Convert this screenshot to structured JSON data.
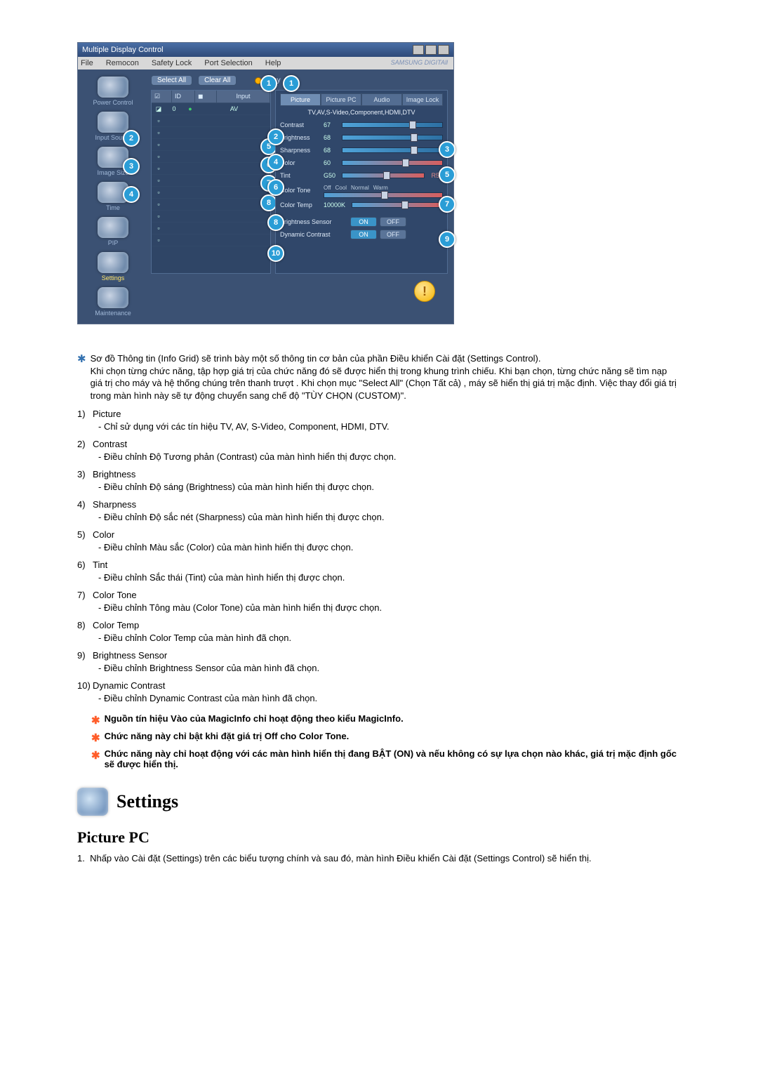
{
  "app": {
    "title": "Multiple Display Control",
    "menu": [
      "File",
      "Remocon",
      "Safety Lock",
      "Port Selection",
      "Help"
    ],
    "brand": "SAMSUNG DIGITAll",
    "buttons": {
      "select_all": "Select All",
      "clear_all": "Clear All",
      "busy": "Busy"
    },
    "sidebar": [
      {
        "label": "Power Control"
      },
      {
        "label": "Input Source"
      },
      {
        "label": "Image Size"
      },
      {
        "label": "Time"
      },
      {
        "label": "PIP"
      },
      {
        "label": "Settings",
        "active": true
      },
      {
        "label": "Maintenance"
      }
    ],
    "grid": {
      "headers": [
        "",
        "ID",
        "",
        "Input"
      ],
      "row0_id": "0",
      "row0_input": "AV"
    },
    "panel": {
      "tabs": [
        "Picture",
        "Picture PC",
        "Audio",
        "Image Lock"
      ],
      "sub": "TV,AV,S-Video,Component,HDMI,DTV",
      "rows": {
        "contrast": {
          "label": "Contrast",
          "val": "67"
        },
        "brightness": {
          "label": "Brightness",
          "val": "68"
        },
        "sharpness": {
          "label": "Sharpness",
          "val": "68"
        },
        "color": {
          "label": "Color",
          "val": "60"
        },
        "tint": {
          "label": "Tint",
          "val": "G50",
          "val2": "R50"
        },
        "tone": {
          "label": "Color Tone",
          "opts": [
            "Off",
            "Cool",
            "Normal",
            "Warm"
          ]
        },
        "temp": {
          "label": "Color Temp",
          "val": "10000K"
        },
        "bsensor": {
          "label": "Brightness Sensor",
          "on": "ON",
          "off": "OFF"
        },
        "dcontrast": {
          "label": "Dynamic Contrast",
          "on": "ON",
          "off": "OFF"
        }
      }
    },
    "side_callouts": {
      "a": "2",
      "b": "3",
      "c": "4"
    },
    "grid_callouts": {
      "top": "1",
      "a": "5",
      "b": "6",
      "c": "7",
      "d": "8"
    },
    "panel_callouts": {
      "top": "1",
      "c2": "2",
      "c3": "3",
      "c4": "4",
      "c5": "5",
      "c6": "6",
      "c7": "7",
      "c8": "8",
      "c9": "9",
      "c10": "10"
    }
  },
  "intro": "Sơ đồ Thông tin (Info Grid) sẽ trình bày một số thông tin cơ bản của phần Điều khiển Cài đặt (Settings Control).\nKhi chọn từng chức năng, tập hợp giá trị của chức năng đó sẽ được hiển thị trong khung trình chiếu. Khi bạn chọn, từng chức năng sẽ tìm nạp giá trị cho máy và hệ thống chúng trên thanh trượt . Khi chọn mục \"Select All\" (Chọn Tất cả) , máy sẽ hiển thị giá trị mặc định. Việc thay đổi giá trị trong màn hình này sẽ tự động chuyển sang chế độ \"TÙY CHỌN (CUSTOM)\".",
  "list": [
    {
      "n": "1)",
      "t": "Picture",
      "s": "- Chỉ sử dụng với các tín hiệu TV, AV, S-Video, Component, HDMI, DTV."
    },
    {
      "n": "2)",
      "t": "Contrast",
      "s": "- Điều chỉnh Độ Tương phản (Contrast) của màn hình hiển thị được chọn."
    },
    {
      "n": "3)",
      "t": "Brightness",
      "s": "- Điều chỉnh Độ sáng (Brightness) của màn hình hiển thị được chọn."
    },
    {
      "n": "4)",
      "t": "Sharpness",
      "s": "- Điều chỉnh Độ sắc nét (Sharpness) của màn hình hiển thị được chọn."
    },
    {
      "n": "5)",
      "t": "Color",
      "s": "- Điều chỉnh Màu sắc (Color) của màn hình hiển thị được chọn."
    },
    {
      "n": "6)",
      "t": "Tint",
      "s": "- Điều chỉnh Sắc thái (Tint) của màn hình hiển thị được chọn."
    },
    {
      "n": "7)",
      "t": "Color Tone",
      "s": "- Điều chỉnh Tông màu (Color Tone) của màn hình hiển thị được chọn."
    },
    {
      "n": "8)",
      "t": "Color Temp",
      "s": "- Điều chỉnh Color Temp của màn hình đã chọn."
    },
    {
      "n": "9)",
      "t": "Brightness Sensor",
      "s": "- Điều chỉnh Brightness Sensor của màn hình đã chọn."
    },
    {
      "n": "10)",
      "t": "Dynamic Contrast",
      "s": "- Điều chỉnh Dynamic Contrast của màn hình đã chọn."
    }
  ],
  "rednotes": [
    "Nguồn tín hiệu Vào của MagicInfo chỉ hoạt động theo kiểu MagicInfo.",
    "Chức năng này chỉ bật khi đặt giá trị Off cho Color Tone.",
    "Chức năng này chỉ hoạt động với các màn hình hiển thị đang BẬT (ON) và nếu không có sự lựa chọn nào khác, giá trị mặc định gốc sẽ được hiển thị."
  ],
  "section": {
    "heading": "Settings",
    "sub": "Picture PC"
  },
  "step1": "Nhấp vào Cài đặt (Settings) trên các biểu tượng chính và sau đó, màn hình Điều khiển Cài đặt (Settings Control) sẽ hiển thị."
}
